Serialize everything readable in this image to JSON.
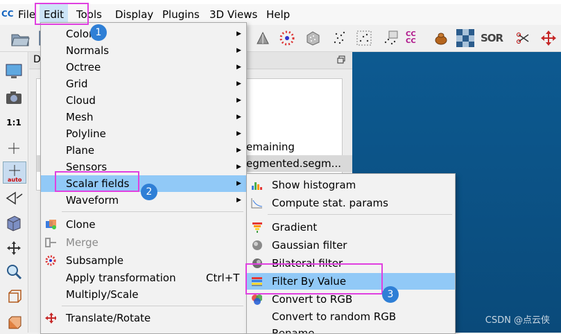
{
  "menubar": {
    "file": "File",
    "edit": "Edit",
    "tools": "Tools",
    "display": "Display",
    "plugins": "Plugins",
    "views3d": "3D Views",
    "help": "Help"
  },
  "app": {
    "logo": "CC"
  },
  "toolbar_text": {
    "sor": "SOR",
    "ccc": "CC CC"
  },
  "left_toolbar": {
    "one_to_one": "1:1",
    "auto": "auto"
  },
  "dock": {
    "title_prefix": "D",
    "rows": [
      "emaining",
      "egmented.segm..."
    ]
  },
  "edit_menu": {
    "items": [
      {
        "label": "Colors"
      },
      {
        "label": "Normals"
      },
      {
        "label": "Octree"
      },
      {
        "label": "Grid"
      },
      {
        "label": "Cloud"
      },
      {
        "label": "Mesh"
      },
      {
        "label": "Polyline"
      },
      {
        "label": "Plane"
      },
      {
        "label": "Sensors"
      },
      {
        "label": "Scalar fields"
      },
      {
        "label": "Waveform"
      },
      {
        "label": "Clone"
      },
      {
        "label": "Merge"
      },
      {
        "label": "Subsample"
      },
      {
        "label": "Apply transformation",
        "shortcut": "Ctrl+T"
      },
      {
        "label": "Multiply/Scale"
      },
      {
        "label": "Translate/Rotate"
      }
    ]
  },
  "scalar_fields_menu": {
    "items": [
      {
        "label": "Show histogram"
      },
      {
        "label": "Compute stat. params"
      },
      {
        "label": "Gradient"
      },
      {
        "label": "Gaussian filter"
      },
      {
        "label": "Bilateral filter"
      },
      {
        "label": "Filter By Value"
      },
      {
        "label": "Convert to RGB"
      },
      {
        "label": "Convert to random RGB"
      },
      {
        "label": "Rename"
      }
    ]
  },
  "annotations": {
    "badge1": "1",
    "badge2": "2",
    "badge3": "3"
  },
  "watermark": "CSDN @点云侠",
  "colors": {
    "highlight": "#91c9f7",
    "annotation_box": "#e040e0",
    "badge": "#2f7fd6",
    "view_bg": "#0b5286"
  }
}
